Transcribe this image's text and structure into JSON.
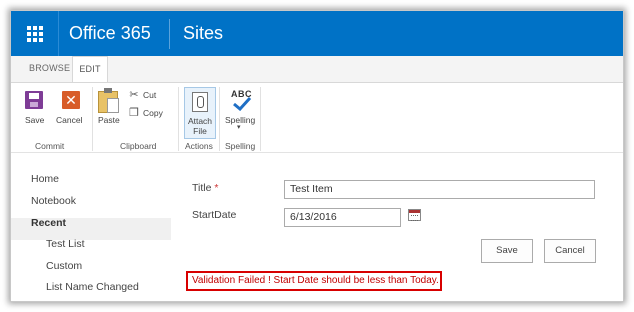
{
  "suite_bar": {
    "brand": "Office 365",
    "site_title": "Sites",
    "accent_color": "#0072c6",
    "icon": "app-launcher-waffle-icon"
  },
  "ribbon_tabs": [
    {
      "label": "BROWSE",
      "active": false
    },
    {
      "label": "EDIT",
      "active": true
    }
  ],
  "ribbon": {
    "commit": {
      "group_label": "Commit",
      "save_label": "Save",
      "cancel_label": "Cancel"
    },
    "clipboard": {
      "group_label": "Clipboard",
      "paste_label": "Paste",
      "cut_label": "Cut",
      "copy_label": "Copy"
    },
    "actions": {
      "group_label": "Actions",
      "attach_line1": "Attach",
      "attach_line2": "File"
    },
    "spelling": {
      "group_label": "Spelling",
      "abc": "ABC",
      "spelling_label": "Spelling"
    }
  },
  "left_nav": {
    "items": [
      {
        "label": "Home",
        "indent": false
      },
      {
        "label": "Notebook",
        "indent": false
      },
      {
        "label": "Recent",
        "indent": false,
        "selected": true
      },
      {
        "label": "Test List",
        "indent": true
      },
      {
        "label": "Custom",
        "indent": true
      },
      {
        "label": "List Name Changed",
        "indent": true
      }
    ]
  },
  "form": {
    "title_label": "Title",
    "required_marker": "*",
    "title_value": "Test Item",
    "startdate_label": "StartDate",
    "startdate_value": "6/13/2016",
    "save_button": "Save",
    "cancel_button": "Cancel"
  },
  "validation": {
    "message": "Validation Failed ! Start Date should be less than Today.",
    "color": "#d80000"
  }
}
